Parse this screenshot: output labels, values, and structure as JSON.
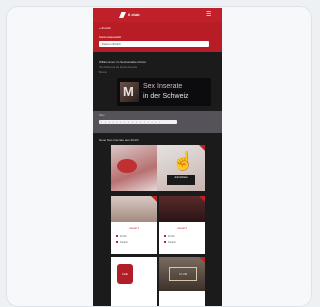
{
  "header": {
    "logo_text": "6 club"
  },
  "nav": {
    "back_label": "« Zurück"
  },
  "search": {
    "label": "Kantonsauswahl",
    "value": "Kanton Zürich"
  },
  "section1": {
    "heading": "Willkommen im Sexkontakte-Portal",
    "line1": "Hier findest du die besten Inserate",
    "line2": "Banner"
  },
  "banner": {
    "line1": "Sex Inserate",
    "line2": "in der Schweiz"
  },
  "filter": {
    "label": "Filter",
    "placeholder": "• • • • • • • • • • • • • • • •"
  },
  "section2": {
    "heading": "Neue Sex-Inserate aus Zürich"
  },
  "thumbs": {
    "button_label": "Jetzt klicken"
  },
  "tiles": [
    {
      "name": "Inserat 1",
      "lines": [
        "Zürich",
        "Details"
      ]
    },
    {
      "name": "Inserat 2",
      "lines": [
        "Zürich",
        "Details"
      ]
    }
  ],
  "tiles_bottom": [
    {
      "plate": "Club"
    },
    {
      "sign": "CLUB"
    }
  ],
  "colors": {
    "brand_red": "#c0202a",
    "dark_bg": "#1b1b1c"
  }
}
